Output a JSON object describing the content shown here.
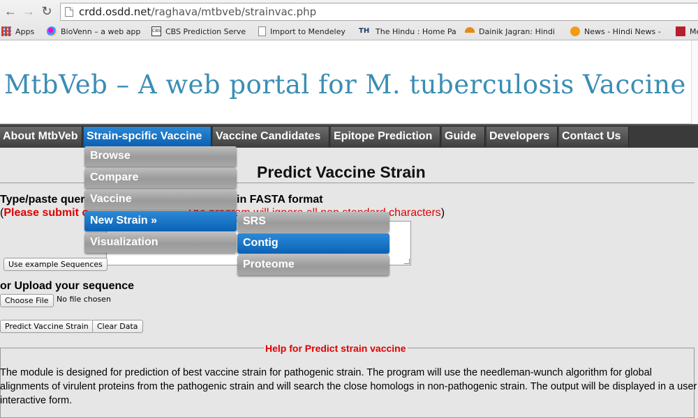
{
  "browser": {
    "url_domain": "crdd.osdd.net",
    "url_path": "/raghava/mtbveb/strainvac.php",
    "bookmarks": [
      {
        "label": "Apps",
        "icon": "apps-grid-icon",
        "color": "#d23f31"
      },
      {
        "label": "BioVenn – a web app",
        "icon": "biovenn-icon",
        "color": "#7b3fa0"
      },
      {
        "label": "CBS Prediction Serve",
        "icon": "cbs-icon",
        "color": "#333333"
      },
      {
        "label": "Import to Mendeley",
        "icon": "page-icon",
        "color": "#888888"
      },
      {
        "label": "The Hindu : Home Pa",
        "icon": "the-hindu-icon",
        "color": "#1a3a6b"
      },
      {
        "label": "Dainik Jagran: Hindi",
        "icon": "dainik-jagran-icon",
        "color": "#e38b14"
      },
      {
        "label": "News - Hindi News -",
        "icon": "news-icon",
        "color": "#f39c12"
      },
      {
        "label": "Me",
        "icon": "mendeley-icon",
        "color": "#b51f2e"
      }
    ]
  },
  "site": {
    "title": "MtbVeb – A web portal for M. tuberculosis Vaccine",
    "menu": [
      {
        "label": "About MtbVeb"
      },
      {
        "label": "Strain-spcific Vaccine"
      },
      {
        "label": "Vaccine Candidates"
      },
      {
        "label": "Epitope Prediction"
      },
      {
        "label": "Guide"
      },
      {
        "label": "Developers"
      },
      {
        "label": "Contact Us"
      }
    ],
    "dropdown": [
      "Browse",
      "Compare",
      "Vaccine",
      "New Strain »",
      "Visualization"
    ],
    "submenu": [
      "SRS",
      "Contig",
      "Proteome"
    ]
  },
  "form": {
    "heading": "Predict Vaccine Strain",
    "type_label_start": "Type/paste quer",
    "type_label_end": "in FASTA format",
    "note_open": "(",
    "note_red": "Please submit o",
    "note_rest": "The program will ignore all non standard characters",
    "note_close": ")",
    "example_button": "Use example Sequences",
    "upload_label": "or Upload your sequence",
    "choose_file": "Choose File",
    "no_file": "No file chosen",
    "predict_button": "Predict Vaccine Strain",
    "clear_button": "Clear Data"
  },
  "help": {
    "legend": "Help for Predict strain vaccine",
    "text": "The module is designed for prediction of best vaccine strain for pathogenic strain. The program will use the needleman-wunch algorithm for global alignments of virulent proteins from the pathogenic strain and will search the close homologs in non-pathogenic strain. The output will be displayed in a user interactive form."
  }
}
